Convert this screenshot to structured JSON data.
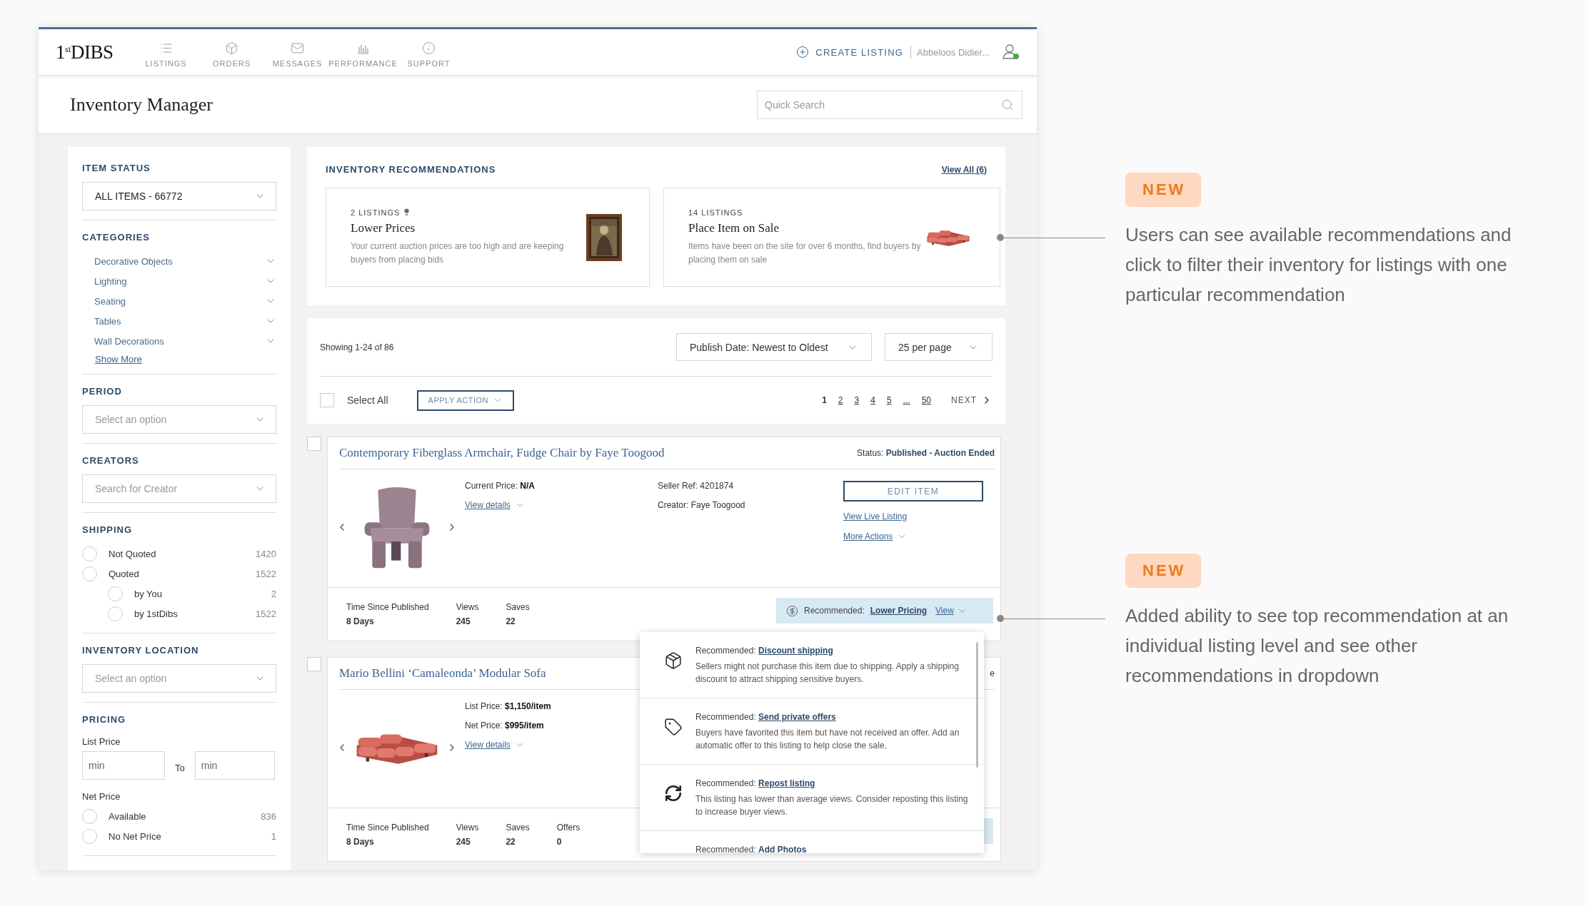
{
  "nav": {
    "logo": "1$^{st}$DIBS",
    "items": [
      {
        "label": "LISTINGS",
        "kind": "list",
        "selected": false
      },
      {
        "label": "ORDERS",
        "kind": "box",
        "selected": false
      },
      {
        "label": "MESSAGES",
        "kind": "mail",
        "selected": false
      },
      {
        "label": "PERFORMANCE",
        "kind": "chart",
        "selected": false
      },
      {
        "label": "SUPPORT",
        "kind": "info",
        "selected": false
      }
    ],
    "create_listing": "CREATE LISTING",
    "user": "Abbeloos Didier..."
  },
  "page_title": "Inventory Manager",
  "search": {
    "placeholder": "Quick Search"
  },
  "sidebar": [
    {
      "kind": "select",
      "title": "ITEM STATUS",
      "value": "ALL ITEMS - 66772"
    },
    {
      "kind": "links",
      "title": "CATEGORIES",
      "items": [
        "Decorative Objects",
        "Lighting",
        "Seating",
        "Tables",
        "Wall Decorations"
      ],
      "more": "Show More"
    },
    {
      "kind": "select",
      "title": "PERIOD",
      "placeholder": "Select an option"
    },
    {
      "kind": "select",
      "title": "CREATORS",
      "placeholder": "Search for Creator"
    },
    {
      "kind": "radios",
      "title": "SHIPPING",
      "options": [
        {
          "label": "Not Quoted",
          "count": "1420",
          "selected": false
        },
        {
          "label": "Quoted",
          "count": "1522",
          "selected": false,
          "children": [
            {
              "label": "by You",
              "count": "2",
              "selected": false
            },
            {
              "label": "by 1stDibs",
              "count": "1522",
              "selected": false
            }
          ]
        }
      ]
    },
    {
      "kind": "select",
      "title": "INVENTORY LOCATION",
      "placeholder": "Select an option"
    },
    {
      "kind": "pricing",
      "title": "PRICING",
      "list_label": "List Price",
      "min_placeholder": "min",
      "to": "To",
      "max_placeholder": "min",
      "net_label": "Net Price",
      "options": [
        {
          "label": "Available",
          "count": "836",
          "selected": false
        },
        {
          "label": "No Net Price",
          "count": "1",
          "selected": false
        }
      ]
    }
  ],
  "recommendations": {
    "title": "INVENTORY RECOMMENDATIONS",
    "view_all": "View All (6)",
    "cards": [
      {
        "count": "2 LISTINGS",
        "flagged": true,
        "title": "Lower Prices",
        "text": "Your current auction prices are too high and are keeping buyers from placing bids",
        "kind": "painting"
      },
      {
        "count": "14 LISTINGS",
        "flagged": false,
        "title": "Place Item on Sale",
        "text": "Items have been on the site for over 6 months, find buyers by placing them on sale",
        "kind": "sofa"
      }
    ]
  },
  "toolbar": {
    "showing": "Showing 1-24 of 86",
    "sort": "Publish Date: Newest to Oldest",
    "per_page": "25 per page",
    "select_all": {
      "label": "Select All",
      "checked": false
    },
    "apply_action": "APPLY ACTION",
    "pages": [
      {
        "label": "1",
        "selected": true
      },
      {
        "label": "2",
        "selected": false
      },
      {
        "label": "3",
        "selected": false
      },
      {
        "label": "4",
        "selected": false
      },
      {
        "label": "5",
        "selected": false
      },
      {
        "label": "...",
        "selected": false
      },
      {
        "label": "50",
        "selected": false
      }
    ],
    "next": "NEXT"
  },
  "listings": [
    {
      "checked": false,
      "title": "Contemporary Fiberglass Armchair, Fudge Chair by Faye Toogood",
      "status": "Status: **Published - Auction Ended**",
      "kind": "chair",
      "prices": [
        "Current Price: **N/A**"
      ],
      "view_details": "View details",
      "seller_ref": "Seller Ref: 4201874",
      "creator": "Creator: Faye Toogood",
      "edit": "EDIT ITEM",
      "links": [
        "View Live Listing",
        "More Actions"
      ],
      "stats": [
        {
          "label": "Time Since Published",
          "value": "8 Days"
        },
        {
          "label": "Views",
          "value": "245"
        },
        {
          "label": "Saves",
          "value": "22"
        }
      ],
      "recommendation": {
        "label": "Recommended:",
        "link": "Lower Pricing",
        "view": "View"
      }
    },
    {
      "checked": false,
      "title": "Mario Bellini ‘Camaleonda’ Modular Sofa",
      "status": "e",
      "kind": "sofa",
      "prices": [
        "List Price: **$1,150/item**",
        "Net Price: **$995/item**"
      ],
      "view_details": "View details",
      "stats": [
        {
          "label": "Time Since Published",
          "value": "8 Days"
        },
        {
          "label": "Views",
          "value": "245"
        },
        {
          "label": "Saves",
          "value": "22"
        },
        {
          "label": "Offers",
          "value": "0"
        }
      ]
    }
  ],
  "recommendation_menu": [
    {
      "kind": "shipping",
      "label": "Recommended:",
      "link": "Discount shipping",
      "text": "Sellers might not purchase this item due to shipping. Apply a shipping discount to attract shipping sensitive buyers."
    },
    {
      "kind": "offer",
      "label": "Recommended:",
      "link": "Send private offers",
      "text": "Buyers have favorited this item but have not received an offer. Add an automatic offer to this listing to help close the sale."
    },
    {
      "kind": "repost",
      "label": "Recommended:",
      "link": "Repost listing",
      "text": "This listing has lower than average views. Consider reposting this listing to increase buyer views."
    },
    {
      "kind": "photos",
      "label": "Recommended:",
      "link": "Add Photos"
    }
  ],
  "annotations": [
    {
      "badge": "NEW",
      "text": "Users can see available recommendations and click to filter their inventory for listings with one particular recommendation"
    },
    {
      "badge": "NEW",
      "text": "Added ability to see top recommendation at an individual listing level and see other recommendations in dropdown"
    }
  ]
}
